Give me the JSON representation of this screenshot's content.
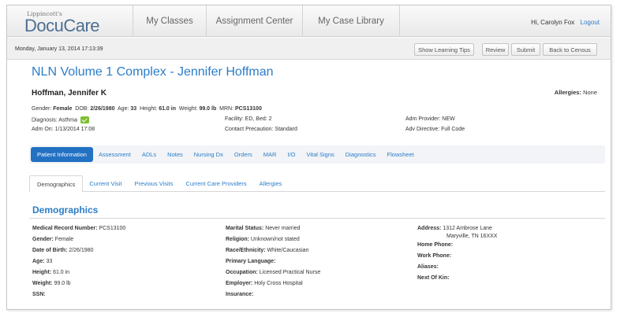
{
  "app": {
    "logo_small": "Lippincott's",
    "logo_big": "DocuCare"
  },
  "nav": {
    "my_classes": "My Classes",
    "assignment_center": "Assignment Center",
    "case_library": "My Case Library",
    "greeting": "Hi, Carolyn Fox",
    "logout": "Logout"
  },
  "actionbar": {
    "datetime": "Monday, January 13, 2014 17:13:39",
    "show_tips": "Show Learning Tips",
    "review": "Review",
    "submit": "Submit",
    "back_to_census": "Back to Census"
  },
  "patient": {
    "title": "NLN Volume 1 Complex - Jennifer Hoffman",
    "name": "Hoffman, Jennifer K",
    "allergies_label": "Allergies:",
    "allergies_value": "None",
    "gender_label": "Gender:",
    "gender": "Female",
    "dob_label": "DOB:",
    "dob": "2/26/1980",
    "age_label": "Age:",
    "age": "33",
    "height_label": "Height:",
    "height": "61.0 in",
    "weight_label": "Weight:",
    "weight": "99.0 lb",
    "mrn_label": "MRN:",
    "mrn": "PCS13100",
    "diagnosis": "Diagnosis: Asthma",
    "facility": "Facility: ED, Bed: 2",
    "adm_provider": "Adm Provider: NEW",
    "adm_on": "Adm On: 1/13/2014 17:08",
    "contact_precaution": "Contact Precaution: Standard",
    "adv_directive": "Adv Directive: Full Code"
  },
  "tabs_primary": [
    "Patient Information",
    "Assessment",
    "ADLs",
    "Notes",
    "Nursing Dx",
    "Orders",
    "MAR",
    "I/O",
    "Vital Signs",
    "Diagnostics",
    "Flowsheet"
  ],
  "tabs_secondary": [
    "Demographics",
    "Current Visit",
    "Previous Visits",
    "Current Care Providers",
    "Allergies"
  ],
  "demographics": {
    "title": "Demographics",
    "col1": [
      {
        "label": "Medical Record Number:",
        "value": "PCS13100"
      },
      {
        "label": "Gender:",
        "value": "Female"
      },
      {
        "label": "Date of Birth:",
        "value": "2/26/1980"
      },
      {
        "label": "Age:",
        "value": "33"
      },
      {
        "label": "Height:",
        "value": "61.0 in"
      },
      {
        "label": "Weight:",
        "value": "99.0 lb"
      },
      {
        "label": "SSN:",
        "value": ""
      }
    ],
    "col2": [
      {
        "label": "Marital Status:",
        "value": "Never married"
      },
      {
        "label": "Religion:",
        "value": "Unknown/not stated"
      },
      {
        "label": "Race/Ethnicity:",
        "value": "White/Caucasian"
      },
      {
        "label": "Primary Language:",
        "value": ""
      },
      {
        "label": "Occupation:",
        "value": "Licensed Practical Nurse"
      },
      {
        "label": "Employer:",
        "value": "Holy Cross Hospital"
      },
      {
        "label": "Insurance:",
        "value": ""
      }
    ],
    "address_label": "Address:",
    "address_line1": "1312 Ambrose Lane",
    "address_line2": "Maryville, TN 16XXX",
    "col3": [
      {
        "label": "Home Phone:",
        "value": ""
      },
      {
        "label": "Work Phone:",
        "value": ""
      },
      {
        "label": "Aliases:",
        "value": ""
      },
      {
        "label": "Next Of Kin:",
        "value": ""
      }
    ]
  }
}
